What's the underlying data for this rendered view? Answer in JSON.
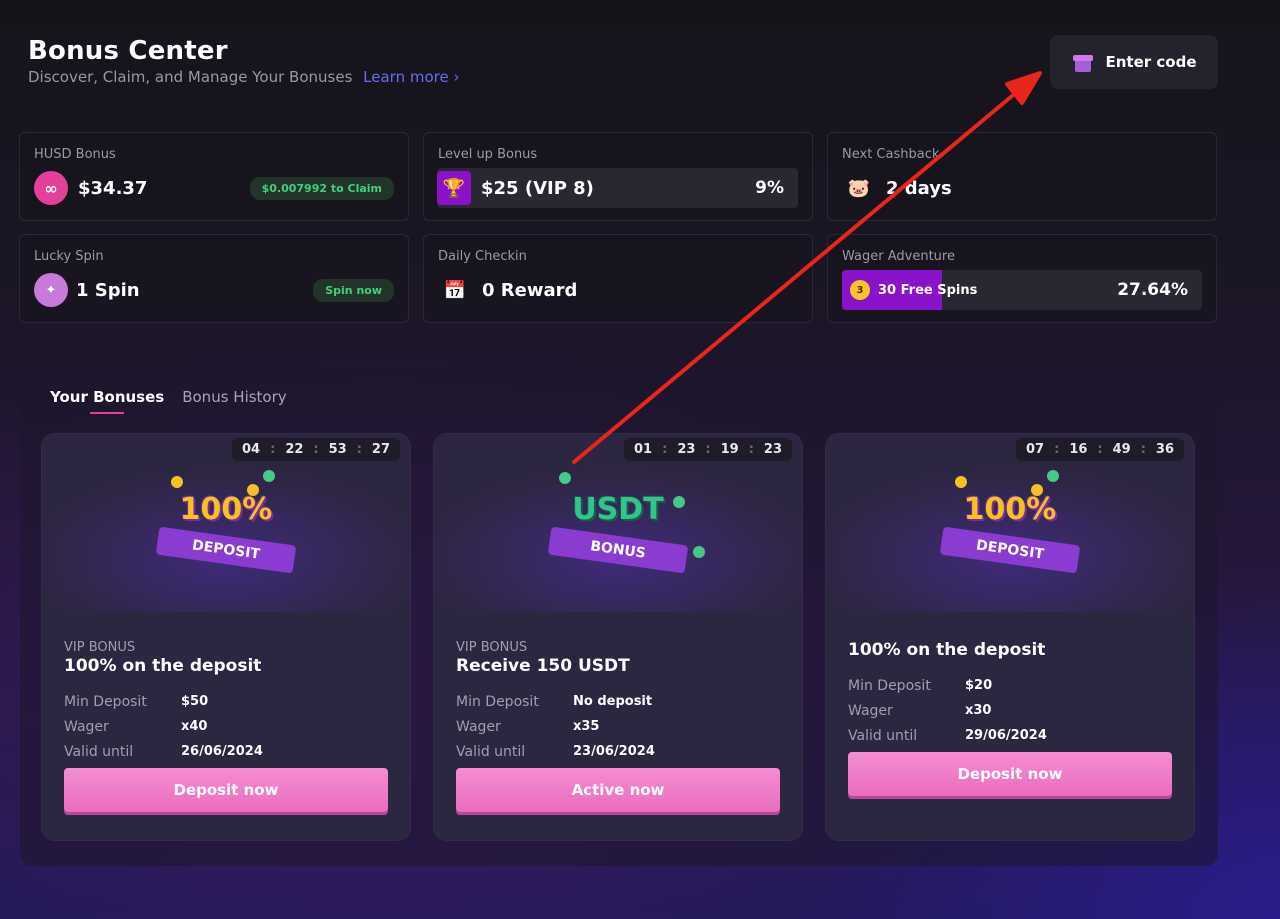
{
  "header": {
    "title": "Bonus Center",
    "subtitle": "Discover, Claim, and Manage Your Bonuses",
    "learn_more": "Learn more ›",
    "enter_code": "Enter code"
  },
  "stats": {
    "husd": {
      "label": "HUSD Bonus",
      "value": "$34.37",
      "claim": "$0.007992 to Claim"
    },
    "levelup": {
      "label": "Level up Bonus",
      "value": "$25  (VIP 8)",
      "percent": "9%"
    },
    "cashback": {
      "label": "Next Cashback",
      "value": "2 days"
    },
    "lucky": {
      "label": "Lucky Spin",
      "value": "1 Spin",
      "action": "Spin now"
    },
    "checkin": {
      "label": "Daily Checkin",
      "value": "0 Reward"
    },
    "wager": {
      "label": "Wager Adventure",
      "badge": "3",
      "value": "30 Free Spins",
      "percent": "27.64%",
      "progress": 0.2764
    }
  },
  "tabs": [
    "Your Bonuses",
    "Bonus History"
  ],
  "cards": [
    {
      "timer": [
        "04",
        "22",
        "53",
        "27"
      ],
      "banner_top": "100%",
      "banner_ribbon": "DEPOSIT",
      "tag": "VIP BONUS",
      "name": "100% on the deposit",
      "rows": [
        [
          "Min Deposit",
          "$50"
        ],
        [
          "Wager",
          "x40"
        ],
        [
          "Valid until",
          "26/06/2024"
        ]
      ],
      "cta": "Deposit now"
    },
    {
      "timer": [
        "01",
        "23",
        "19",
        "23"
      ],
      "banner_top": "USDT",
      "banner_ribbon": "BONUS",
      "tag": "VIP BONUS",
      "name": "Receive 150 USDT",
      "rows": [
        [
          "Min Deposit",
          "No deposit"
        ],
        [
          "Wager",
          "x35"
        ],
        [
          "Valid until",
          "23/06/2024"
        ]
      ],
      "cta": "Active now"
    },
    {
      "timer": [
        "07",
        "16",
        "49",
        "36"
      ],
      "banner_top": "100%",
      "banner_ribbon": "DEPOSIT",
      "tag": "",
      "name": "100% on the deposit",
      "rows": [
        [
          "Min Deposit",
          "$20"
        ],
        [
          "Wager",
          "x30"
        ],
        [
          "Valid until",
          "29/06/2024"
        ]
      ],
      "cta": "Deposit now"
    }
  ],
  "colors": {
    "accent_pink": "#ea6cbf",
    "claim_green": "#3fd17c",
    "wager_purple": "#8a12c9",
    "arrow_red": "#e8261c"
  }
}
